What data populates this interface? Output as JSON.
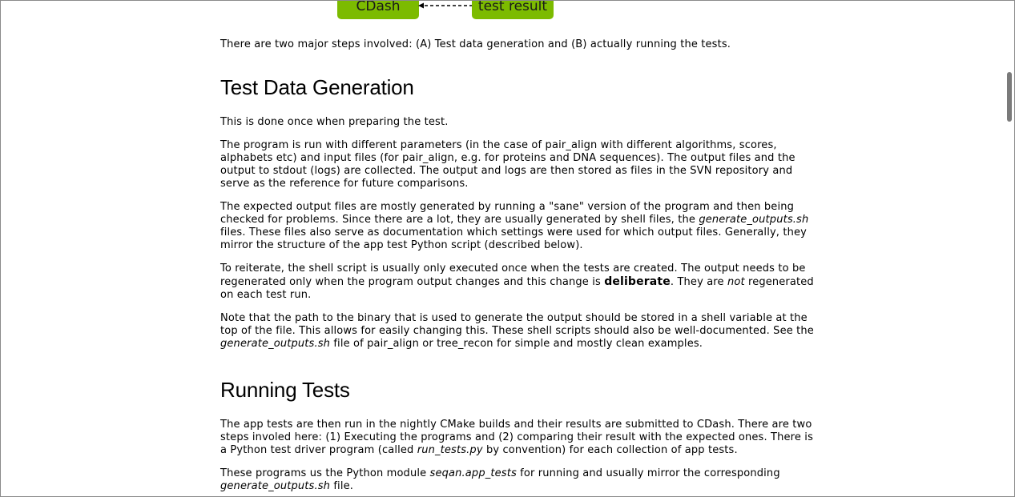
{
  "diagram": {
    "left_box": "CDash",
    "right_box": "test result"
  },
  "intro": "There are two major steps involved: (A) Test data generation and (B) actually running the tests.",
  "section1": {
    "heading": "Test Data Generation",
    "p1": "This is done once when preparing the test.",
    "p2": "The program is run with different parameters (in the case of pair_align with different algorithms, scores, alphabets etc) and input files (for pair_align, e.g. for proteins and DNA sequences). The output files and the output to stdout (logs) are collected. The output and logs are then stored as files in the SVN repository and serve as the reference for future comparisons.",
    "p3_a": "The expected output files are mostly generated by running a \"sane\" version of the program and then being checked for problems. Since there are a lot, they are usually generated by shell files, the ",
    "p3_em": "generate_outputs.sh",
    "p3_b": " files. These files also serve as documentation which settings were used for which output files. Generally, they mirror the structure of the app test Python script (described below).",
    "p4_a": "To reiterate, the shell script is usually only executed once when the tests are created. The output needs to be regenerated only when the program output changes and this change is ",
    "p4_bold": "deliberate",
    "p4_b": ". They are ",
    "p4_em": "not",
    "p4_c": " regenerated on each test run.",
    "p5_a": "Note that the path to the binary that is used to generate the output should be stored in a shell variable at the top of the file. This allows for easily changing this. These shell scripts should also be well-documented. See the ",
    "p5_em": "generate_outputs.sh",
    "p5_b": " file of pair_align or tree_recon for simple and mostly clean examples."
  },
  "section2": {
    "heading": "Running Tests",
    "p1_a": "The app tests are then run in the nightly CMake builds and their results are submitted to CDash. There are two steps involed here: (1) Executing the programs and (2) comparing their result with the expected ones. There is a Python test driver program (called ",
    "p1_em": "run_tests.py",
    "p1_b": " by convention) for each collection of app tests.",
    "p2_a": "These programs us the Python module ",
    "p2_em": "seqan.app_tests",
    "p2_b": " for running and usually mirror the corresponding ",
    "p2_em2": "generate_outputs.sh",
    "p2_c": " file."
  }
}
